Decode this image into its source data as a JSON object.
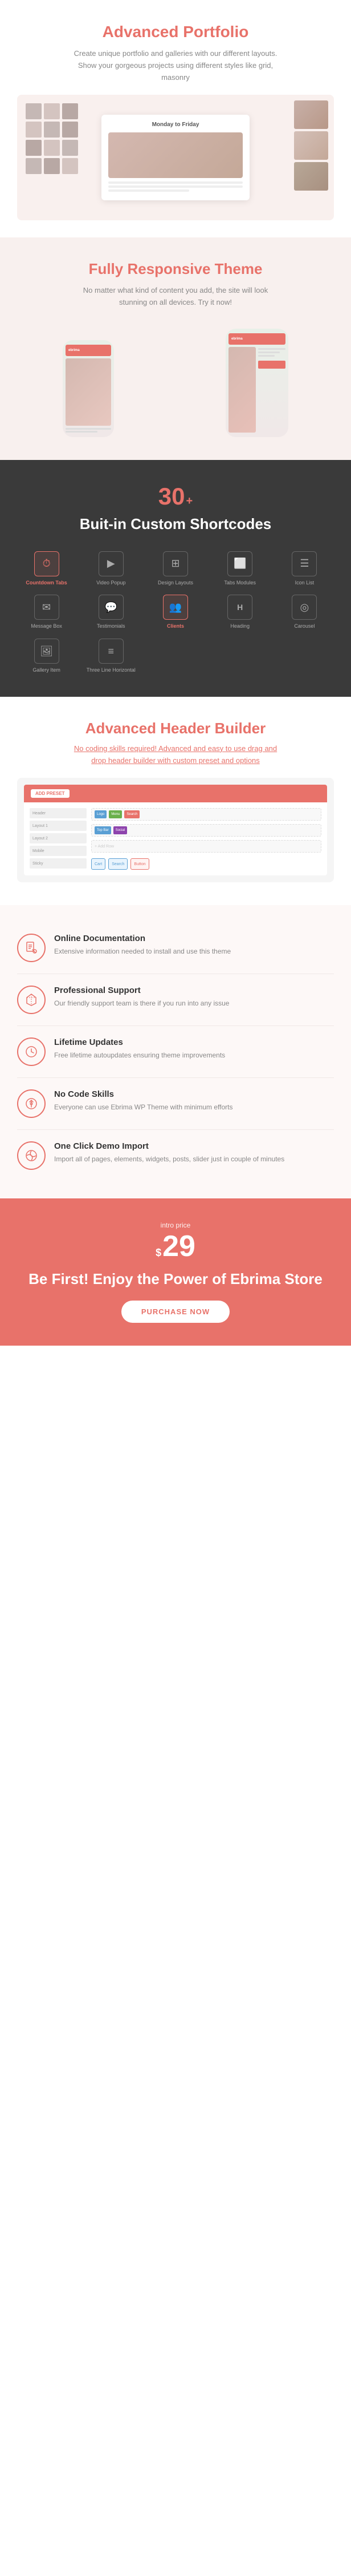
{
  "portfolio": {
    "title": "Advanced Portfolio",
    "description": "Create unique portfolio and galleries with our different layouts. Show your gorgeous projects using different styles like grid, masonry",
    "card_title": "Monday to Friday"
  },
  "responsive": {
    "title": "Fully Responsive Theme",
    "description": "No matter what kind of content you add, the site will look stunning on all devices. Try it now!",
    "phone_left_label": "ebrima",
    "phone_right_label": "ebrima"
  },
  "shortcodes": {
    "number": "30",
    "plus": "+",
    "title": "Buit-in Custom Shortcodes",
    "items": [
      {
        "label": "Countdown Tabs",
        "icon": "⏱",
        "highlight": true
      },
      {
        "label": "Video Popup",
        "icon": "▶",
        "highlight": false
      },
      {
        "label": "Design Layouts",
        "icon": "⊞",
        "highlight": false
      },
      {
        "label": "Tabs Modules",
        "icon": "⬜",
        "highlight": false
      },
      {
        "label": "Icon List",
        "icon": "☰",
        "highlight": false
      },
      {
        "label": "Message Box",
        "icon": "✉",
        "highlight": false
      },
      {
        "label": "Testimonials",
        "icon": "💬",
        "highlight": false
      },
      {
        "label": "Clients",
        "icon": "👥",
        "highlight": true
      },
      {
        "label": "Heading",
        "icon": "H",
        "highlight": false
      },
      {
        "label": "Carousel",
        "icon": "◎",
        "highlight": false
      },
      {
        "label": "Gallery Item",
        "icon": "🖼",
        "highlight": false
      },
      {
        "label": "Three Line Horizontal",
        "icon": "≡",
        "highlight": false
      }
    ]
  },
  "header_builder": {
    "title": "Advanced Header Builder",
    "description_before": "No coding skills required! Advanced and easy to use drag and drop header builder with ",
    "link_text": "custom preset and options",
    "add_preset_label": "ADD PRESET",
    "builder_rows": [
      {
        "blocks": [
          "Logo",
          "Menu",
          "Search"
        ]
      },
      {
        "blocks": [
          "Top Bar",
          "Social"
        ]
      }
    ]
  },
  "features": [
    {
      "icon": "📋",
      "title": "Online Documentation",
      "description": "Extensive information needed to install and use this theme"
    },
    {
      "icon": "✈",
      "title": "Professional Support",
      "description": "Our friendly support team is there if you run into any issue"
    },
    {
      "icon": "⏰",
      "title": "Lifetime Updates",
      "description": "Free lifetime autoupdates ensuring theme improvements"
    },
    {
      "icon": "⚙",
      "title": "No Code Skills",
      "description": "Everyone can use Ebrima WP Theme with minimum efforts"
    },
    {
      "icon": "🔑",
      "title": "One Click Demo Import",
      "description": "Import all of pages, elements, widgets, posts, slider just in couple of minutes"
    }
  ],
  "cta": {
    "intro": "intro price",
    "dollar": "$",
    "price": "29",
    "title": "Be First! Enjoy the Power of Ebrima Store",
    "button_label": "PURCHASE NOW"
  }
}
